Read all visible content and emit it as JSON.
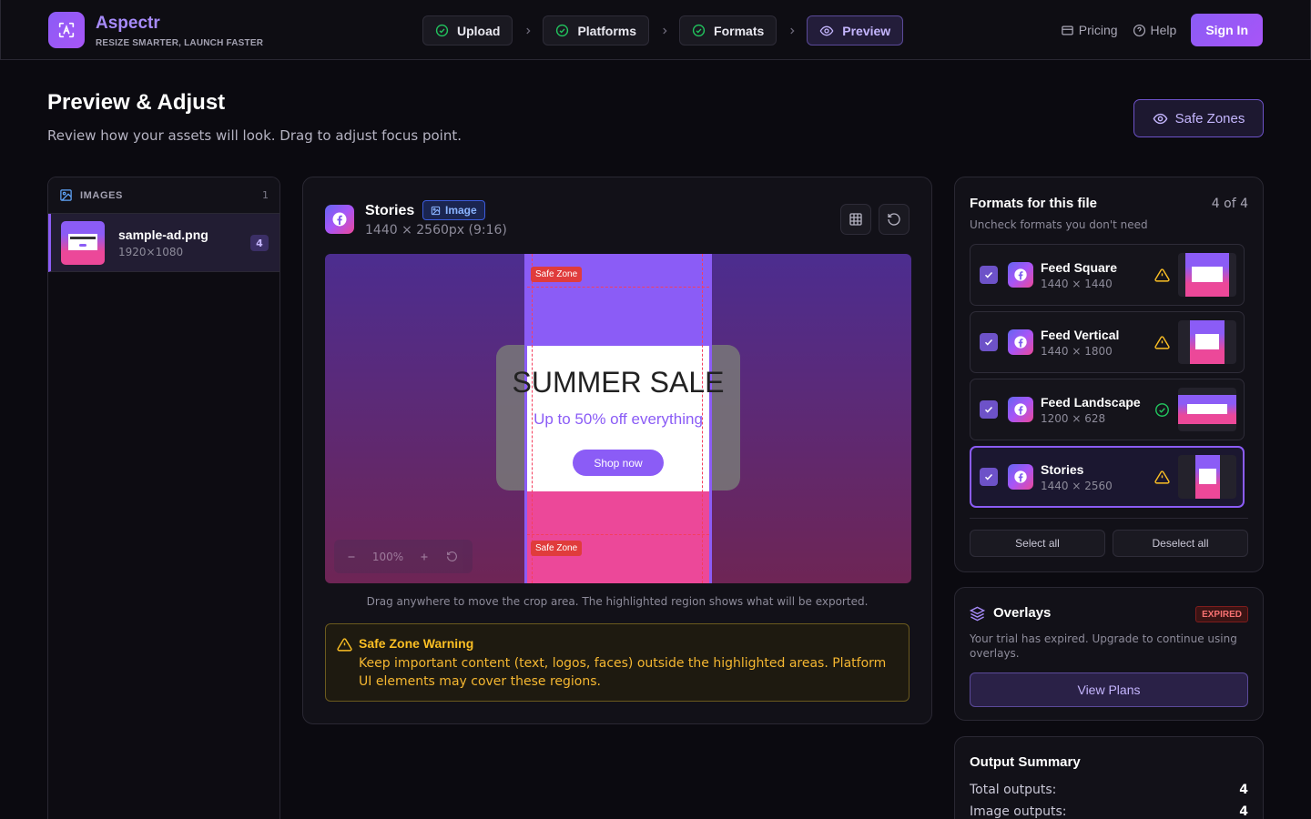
{
  "app": {
    "name": "Aspectr",
    "tagline": "RESIZE SMARTER, LAUNCH FASTER"
  },
  "steps": [
    {
      "label": "Upload",
      "icon": "check-circle-icon",
      "state": "done"
    },
    {
      "label": "Platforms",
      "icon": "check-circle-icon",
      "state": "done"
    },
    {
      "label": "Formats",
      "icon": "check-circle-icon",
      "state": "done"
    },
    {
      "label": "Preview",
      "icon": "eye-icon",
      "state": "active"
    }
  ],
  "nav": {
    "pricing": "Pricing",
    "help": "Help",
    "sign_in": "Sign In"
  },
  "page": {
    "title": "Preview & Adjust",
    "subtitle": "Review how your assets will look. Drag to adjust focus point.",
    "safe_zones_button": "Safe Zones"
  },
  "images_panel": {
    "label": "IMAGES",
    "count": "1",
    "files": [
      {
        "name": "sample-ad.png",
        "dims": "1920×1080",
        "badge": "4"
      }
    ]
  },
  "preview": {
    "format_name": "Stories",
    "type_tag": "Image",
    "dims": "1440 × 2560px (9:16)",
    "safe_zone_label_top": "Safe Zone",
    "safe_zone_label_bottom": "Safe Zone",
    "ad_title": "SUMMER SALE",
    "ad_subtitle": "Up to 50% off everything",
    "ad_button": "Shop now",
    "zoom_level": "100%",
    "hint": "Drag anywhere to move the crop area. The highlighted region shows what will be exported."
  },
  "warning": {
    "title": "Safe Zone Warning",
    "text": "Keep important content (text, logos, faces) outside the highlighted areas. Platform UI elements may cover these regions."
  },
  "formats_panel": {
    "title": "Formats for this file",
    "count": "4 of 4",
    "subtitle": "Uncheck formats you don't need",
    "formats": [
      {
        "name": "Feed Square",
        "dims": "1440 × 1440",
        "status": "warning",
        "checked": true,
        "selected": false
      },
      {
        "name": "Feed Vertical",
        "dims": "1440 × 1800",
        "status": "warning",
        "checked": true,
        "selected": false
      },
      {
        "name": "Feed Landscape",
        "dims": "1200 × 628",
        "status": "ok",
        "checked": true,
        "selected": false
      },
      {
        "name": "Stories",
        "dims": "1440 × 2560",
        "status": "warning",
        "checked": true,
        "selected": true
      }
    ],
    "select_all": "Select all",
    "deselect_all": "Deselect all"
  },
  "overlays": {
    "title": "Overlays",
    "badge": "EXPIRED",
    "text": "Your trial has expired. Upgrade to continue using overlays.",
    "button": "View Plans"
  },
  "summary": {
    "title": "Output Summary",
    "rows": [
      {
        "label": "Total outputs:",
        "value": "4"
      },
      {
        "label": "Image outputs:",
        "value": "4"
      }
    ]
  },
  "colors": {
    "accent": "#8b5cf6",
    "pink": "#ec4899",
    "warning": "#fbbf24",
    "success": "#22c55e",
    "danger": "#e03c3c"
  }
}
